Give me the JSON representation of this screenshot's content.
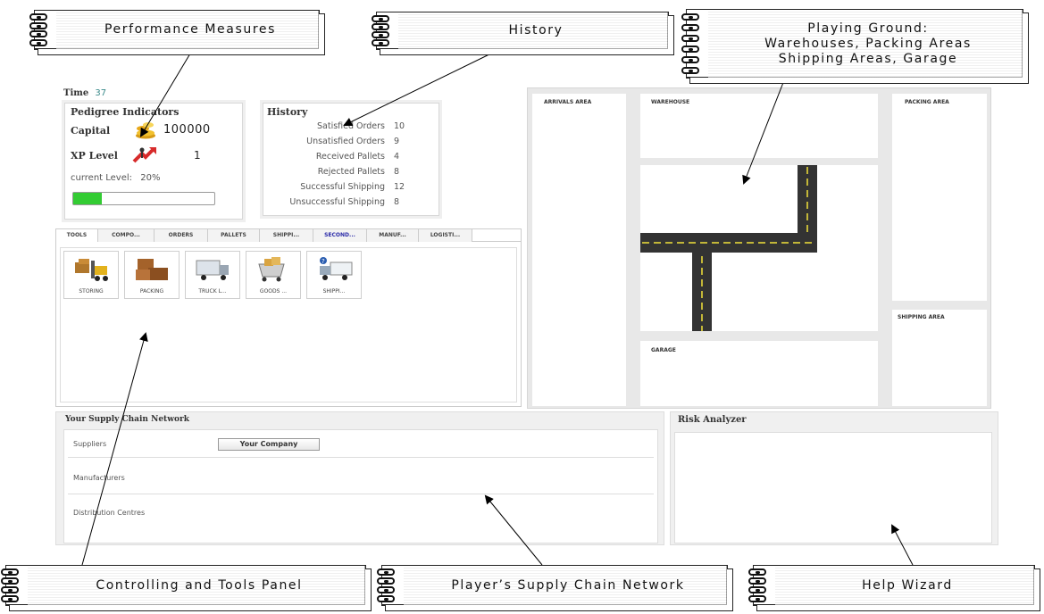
{
  "callouts": {
    "performance": "Performance Measures",
    "history": "History",
    "playing_ground_line1": "Playing Ground:",
    "playing_ground_line2": "Warehouses, Packing Areas",
    "playing_ground_line3": "Shipping Areas, Garage",
    "controlling": "Controlling and Tools Panel",
    "supply_chain": "Player’s Supply Chain Network",
    "help": "Help Wizard"
  },
  "time": {
    "label": "Time",
    "value": "37"
  },
  "pedigree": {
    "title": "Pedigree Indicators",
    "capital_label": "Capital",
    "capital_value": "100000",
    "xp_label": "XP Level",
    "xp_value": "1",
    "current_level_label": "current Level:",
    "current_level_value": "20%",
    "progress": 0.2
  },
  "history": {
    "title": "History",
    "rows": [
      {
        "label": "Satisfied Orders",
        "value": "10"
      },
      {
        "label": "Unsatisfied Orders",
        "value": "9"
      },
      {
        "label": "Received Pallets",
        "value": "4"
      },
      {
        "label": "Rejected Pallets",
        "value": "8"
      },
      {
        "label": "Successful Shipping",
        "value": "12"
      },
      {
        "label": "Unsuccessful Shipping",
        "value": "8"
      }
    ]
  },
  "tabs": [
    "TOOLS",
    "COMPO...",
    "ORDERS",
    "PALLETS",
    "SHIPPI...",
    "SECOND...",
    "MANUF...",
    "LOGISTI..."
  ],
  "tools": [
    "STORING",
    "PACKING",
    "TRUCK L...",
    "GOODS ...",
    "SHIPPI..."
  ],
  "ground": {
    "arrivals": "ARRIVALS AREA",
    "warehouse": "WAREHOUSE",
    "packing": "PACKING AREA",
    "shipping": "SHIPPING AREA",
    "garage": "GARAGE"
  },
  "network": {
    "title": "Your Supply Chain Network",
    "suppliers": "Suppliers",
    "your_company": "Your Company",
    "manufacturers": "Manufacturers",
    "distribution": "Distribution Centres"
  },
  "risk": {
    "title": "Risk Analyzer"
  },
  "colors": {
    "progress_green": "#33cc33",
    "road": "#333333",
    "road_marking": "#f2e23a"
  }
}
